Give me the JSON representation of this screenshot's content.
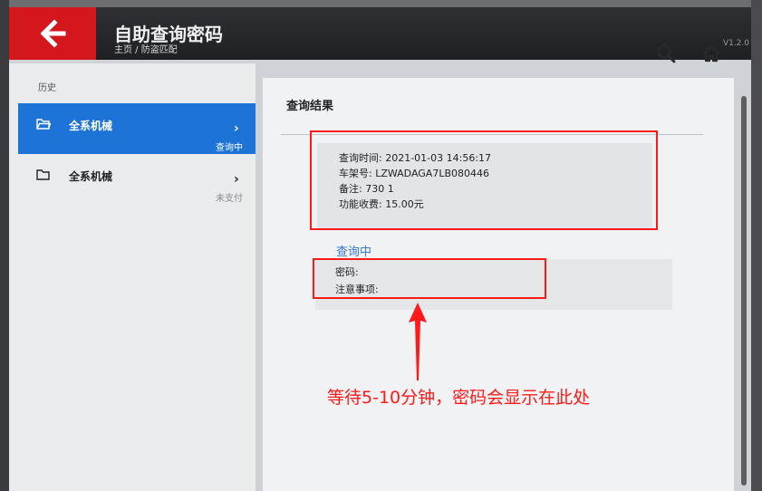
{
  "app": {
    "title": "自助查询密码",
    "breadcrumb": "主页 / 防盗匹配",
    "version": "V1.2.0"
  },
  "sidebar": {
    "title": "历史",
    "items": [
      {
        "label": "全系机械",
        "status": "查询中",
        "active": true
      },
      {
        "label": "全系机械",
        "status": "未支付",
        "active": false
      }
    ]
  },
  "main": {
    "title": "查询结果",
    "info": {
      "query_time": "查询时间: 2021-01-03 14:56:17",
      "vin": "车架号: LZWADAGA7LB080446",
      "remark": "备注: 730 1",
      "fee": "功能收费: 15.00元"
    },
    "status": "查询中",
    "password_label": "密码:",
    "notes_label": "注意事项:"
  },
  "annotation": {
    "text": "等待5-10分钟，密码会显示在此处",
    "color": "#ff1a1a"
  },
  "colors": {
    "accent_red": "#d3171d",
    "accent_blue": "#1d74d6"
  },
  "icons": {
    "back": "back-arrow-icon",
    "search": "search-icon",
    "home": "home-icon",
    "folder": "folder-icon"
  }
}
